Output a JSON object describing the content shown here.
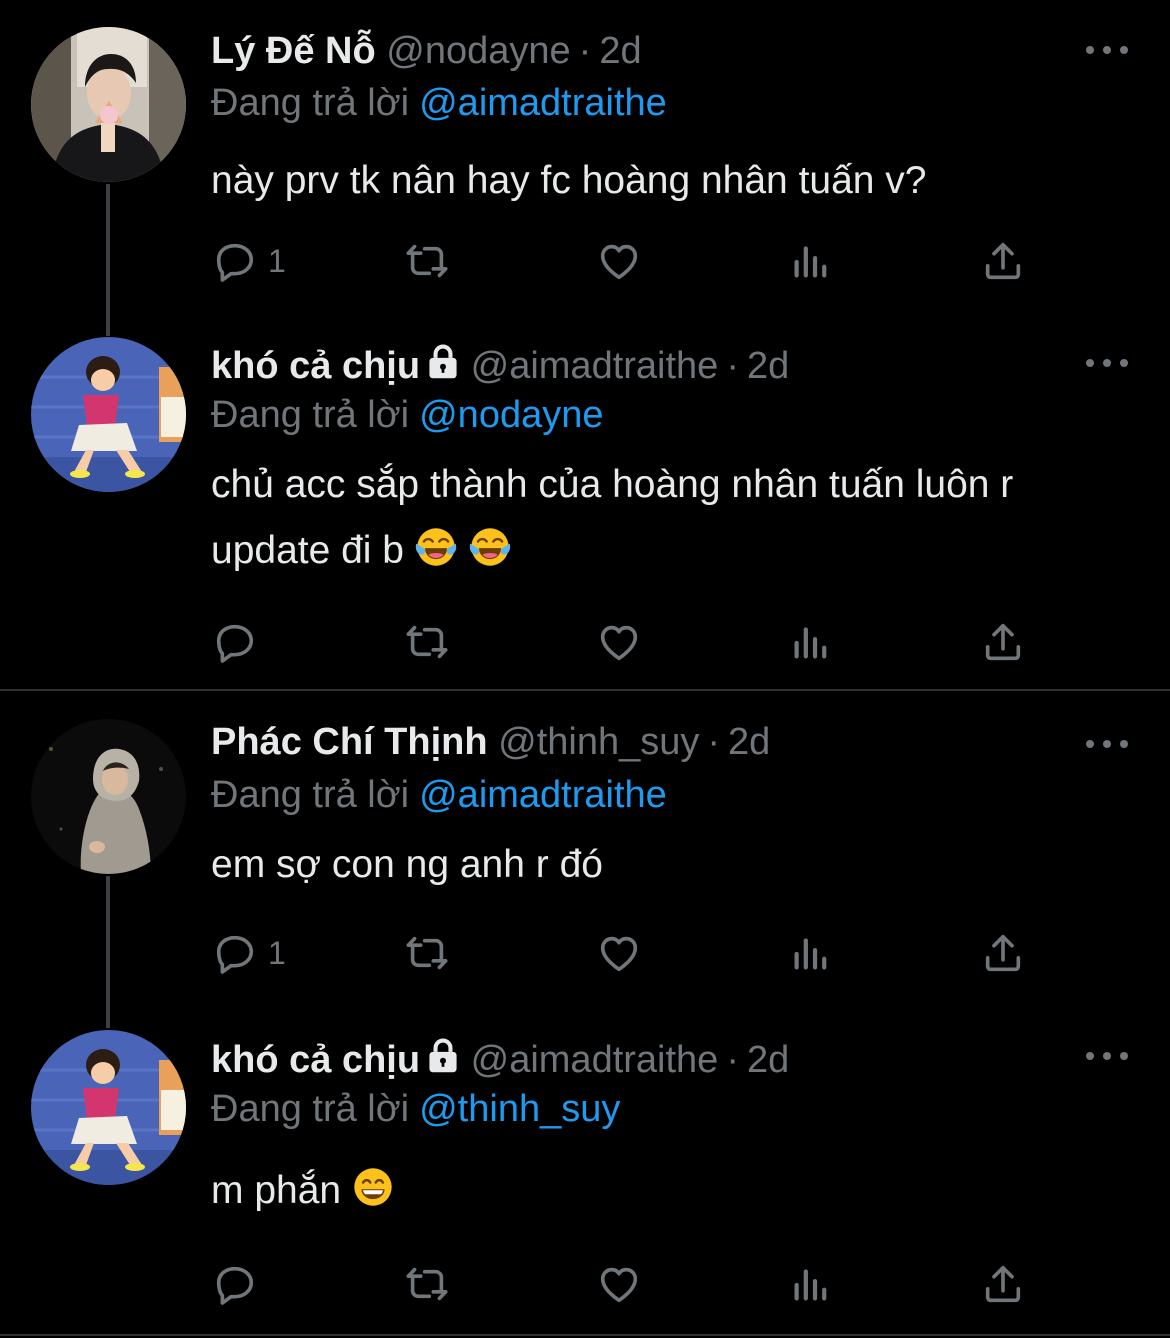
{
  "colors": {
    "background": "#000000",
    "text": "#e7e9ea",
    "muted": "#71767b",
    "accent": "#1d9bf0",
    "divider": "#2f3336",
    "thread_line": "#3e4144"
  },
  "replying_prefix": "Đang trả lời",
  "tweets": [
    {
      "display_name": "Lý Đế Nỗ",
      "handle": "@nodayne",
      "separator": "·",
      "time": "2d",
      "reply_to": "@aimadtraithe",
      "text": "này prv tk nân hay fc hoàng nhân tuấn v?",
      "reply_count": "1",
      "locked": false,
      "avatar": "photo-avatar-man-eating-ice-cream"
    },
    {
      "display_name": "khó cả chịu",
      "handle": "@aimadtraithe",
      "separator": "·",
      "time": "2d",
      "reply_to": "@nodayne",
      "text": "chủ acc sắp thành của hoàng nhân tuấn luôn r update đi b",
      "emojis": [
        "face-with-tears-of-joy",
        "face-with-tears-of-joy"
      ],
      "reply_count": "",
      "locked": true,
      "avatar": "cartoon-avatar-girl-dancing"
    },
    {
      "display_name": "Phác Chí Thịnh",
      "handle": "@thinh_suy",
      "separator": "·",
      "time": "2d",
      "reply_to": "@aimadtraithe",
      "text": "em sợ con ng anh r đó",
      "reply_count": "1",
      "locked": false,
      "avatar": "photo-avatar-man-in-hoodie-night"
    },
    {
      "display_name": "khó cả chịu",
      "handle": "@aimadtraithe",
      "separator": "·",
      "time": "2d",
      "reply_to": "@thinh_suy",
      "text": "m phắn",
      "emojis": [
        "grinning-face-with-smiling-eyes"
      ],
      "reply_count": "",
      "locked": true,
      "avatar": "cartoon-avatar-girl-dancing"
    }
  ],
  "action_icons": [
    "reply-icon",
    "retweet-icon",
    "like-icon",
    "views-icon",
    "share-icon"
  ]
}
